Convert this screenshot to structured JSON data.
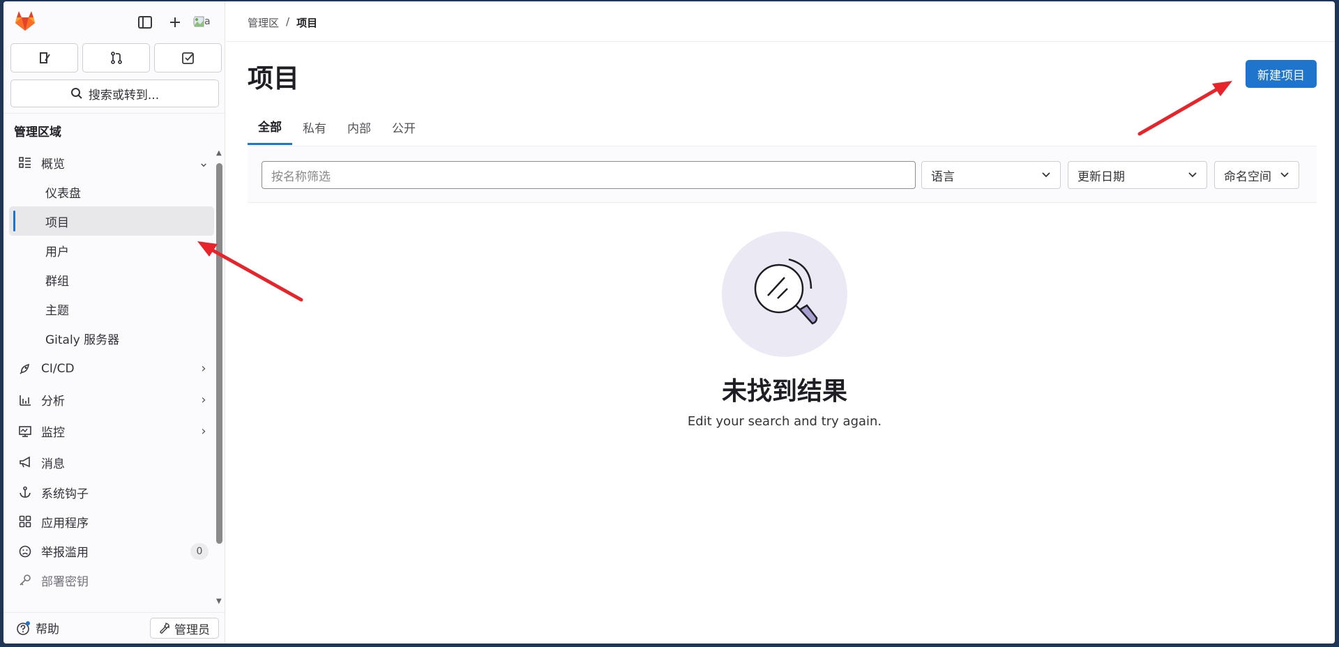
{
  "sidebar": {
    "search_label": "搜索或转到...",
    "avatar_alt": "a",
    "section_title": "管理区域",
    "overview_label": "概览",
    "sub_items": [
      {
        "label": "仪表盘"
      },
      {
        "label": "项目"
      },
      {
        "label": "用户"
      },
      {
        "label": "群组"
      },
      {
        "label": "主题"
      },
      {
        "label": "Gitaly 服务器"
      }
    ],
    "items": [
      {
        "label": "CI/CD",
        "icon": "rocket-icon"
      },
      {
        "label": "分析",
        "icon": "chart-icon"
      },
      {
        "label": "监控",
        "icon": "monitor-icon"
      },
      {
        "label": "消息",
        "icon": "megaphone-icon"
      },
      {
        "label": "系统钩子",
        "icon": "anchor-icon"
      },
      {
        "label": "应用程序",
        "icon": "apps-icon"
      },
      {
        "label": "举报滥用",
        "icon": "abuse-icon",
        "badge": "0"
      },
      {
        "label": "部署密钥",
        "icon": "key-icon"
      }
    ],
    "help_label": "帮助",
    "admin_label": "管理员"
  },
  "breadcrumb": {
    "root": "管理区",
    "separator": "/",
    "current": "项目"
  },
  "page": {
    "title": "项目",
    "new_button": "新建项目"
  },
  "tabs": [
    {
      "label": "全部",
      "active": true
    },
    {
      "label": "私有"
    },
    {
      "label": "内部"
    },
    {
      "label": "公开"
    }
  ],
  "filters": {
    "name_placeholder": "按名称筛选",
    "language": "语言",
    "sort": "更新日期",
    "namespace": "命名空间"
  },
  "empty_state": {
    "title": "未找到结果",
    "description": "Edit your search and try again."
  },
  "colors": {
    "accent": "#1f75cb",
    "annotation_arrow": "#e8232a"
  }
}
